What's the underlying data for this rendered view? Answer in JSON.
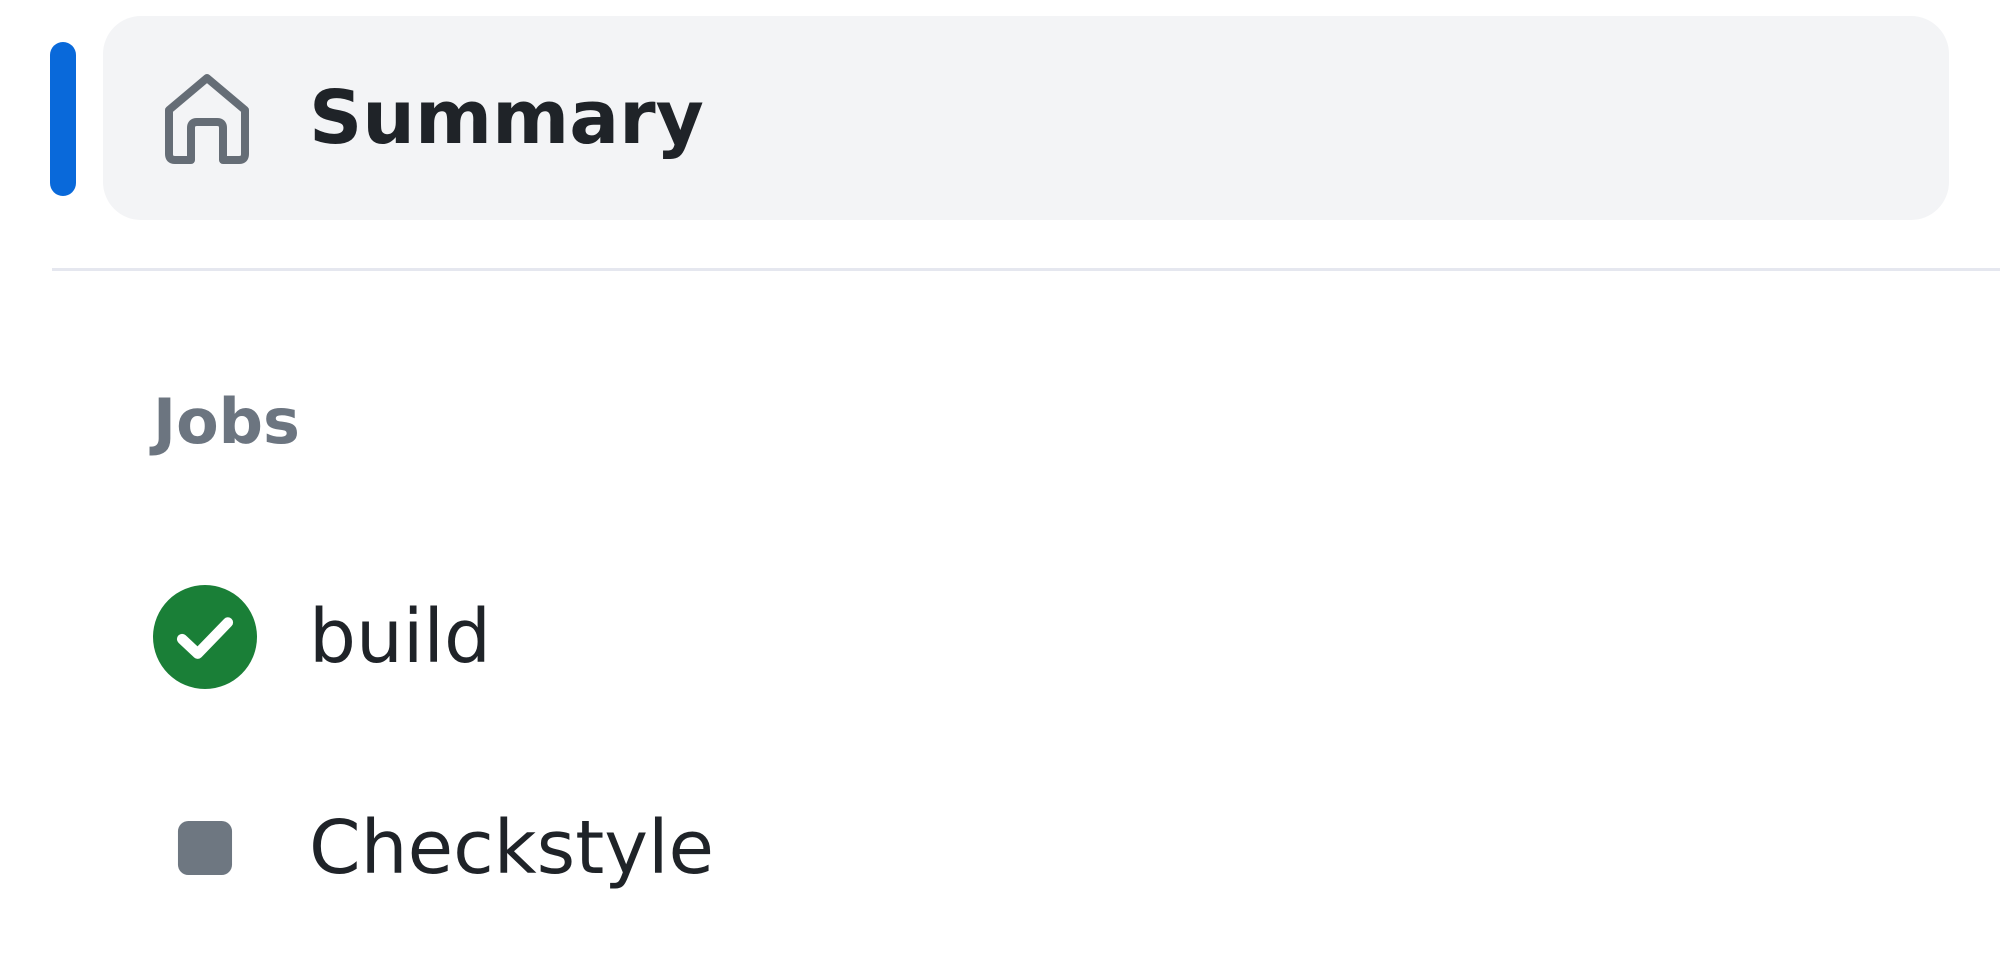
{
  "summary": {
    "label": "Summary",
    "icon": "home-icon",
    "active": true,
    "indicator_color": "#0969da",
    "background_color": "#f3f4f6"
  },
  "jobs": {
    "heading": "Jobs",
    "items": [
      {
        "label": "build",
        "status": "success",
        "icon": "check-circle-fill-icon",
        "color": "#1a7f37"
      },
      {
        "label": "Checkstyle",
        "status": "cancelled",
        "icon": "square-fill-icon",
        "color": "#6e7781"
      }
    ]
  }
}
